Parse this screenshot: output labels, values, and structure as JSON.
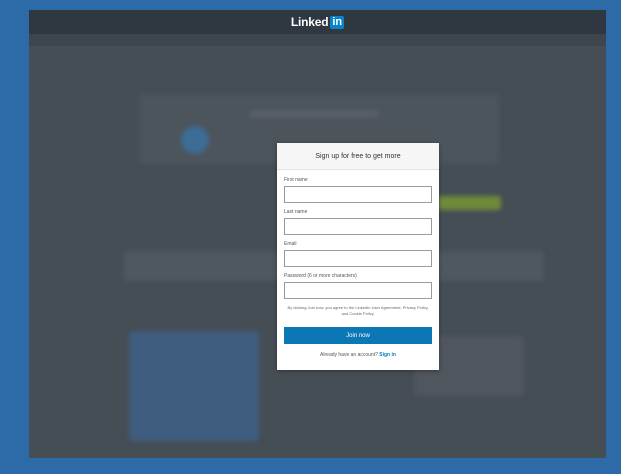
{
  "header": {
    "logo_text": "Linked",
    "logo_badge": "in"
  },
  "modal": {
    "title": "Sign up for free to get more",
    "fields": [
      {
        "label": "First name",
        "value": ""
      },
      {
        "label": "Last name",
        "value": ""
      },
      {
        "label": "Email",
        "value": ""
      },
      {
        "label": "Password (6 or more characters)",
        "value": ""
      }
    ],
    "legal_text": "By clicking Join now, you agree to the LinkedIn User Agreement, Privacy Policy, and Cookie Policy.",
    "join_label": "Join now",
    "signin_prompt": "Already have an account?",
    "signin_link": "Sign in"
  },
  "colors": {
    "page_background": "#2c6aa8",
    "frame_background": "#454d55",
    "topbar": "#2f3740",
    "brand_blue": "#0b78b5"
  }
}
